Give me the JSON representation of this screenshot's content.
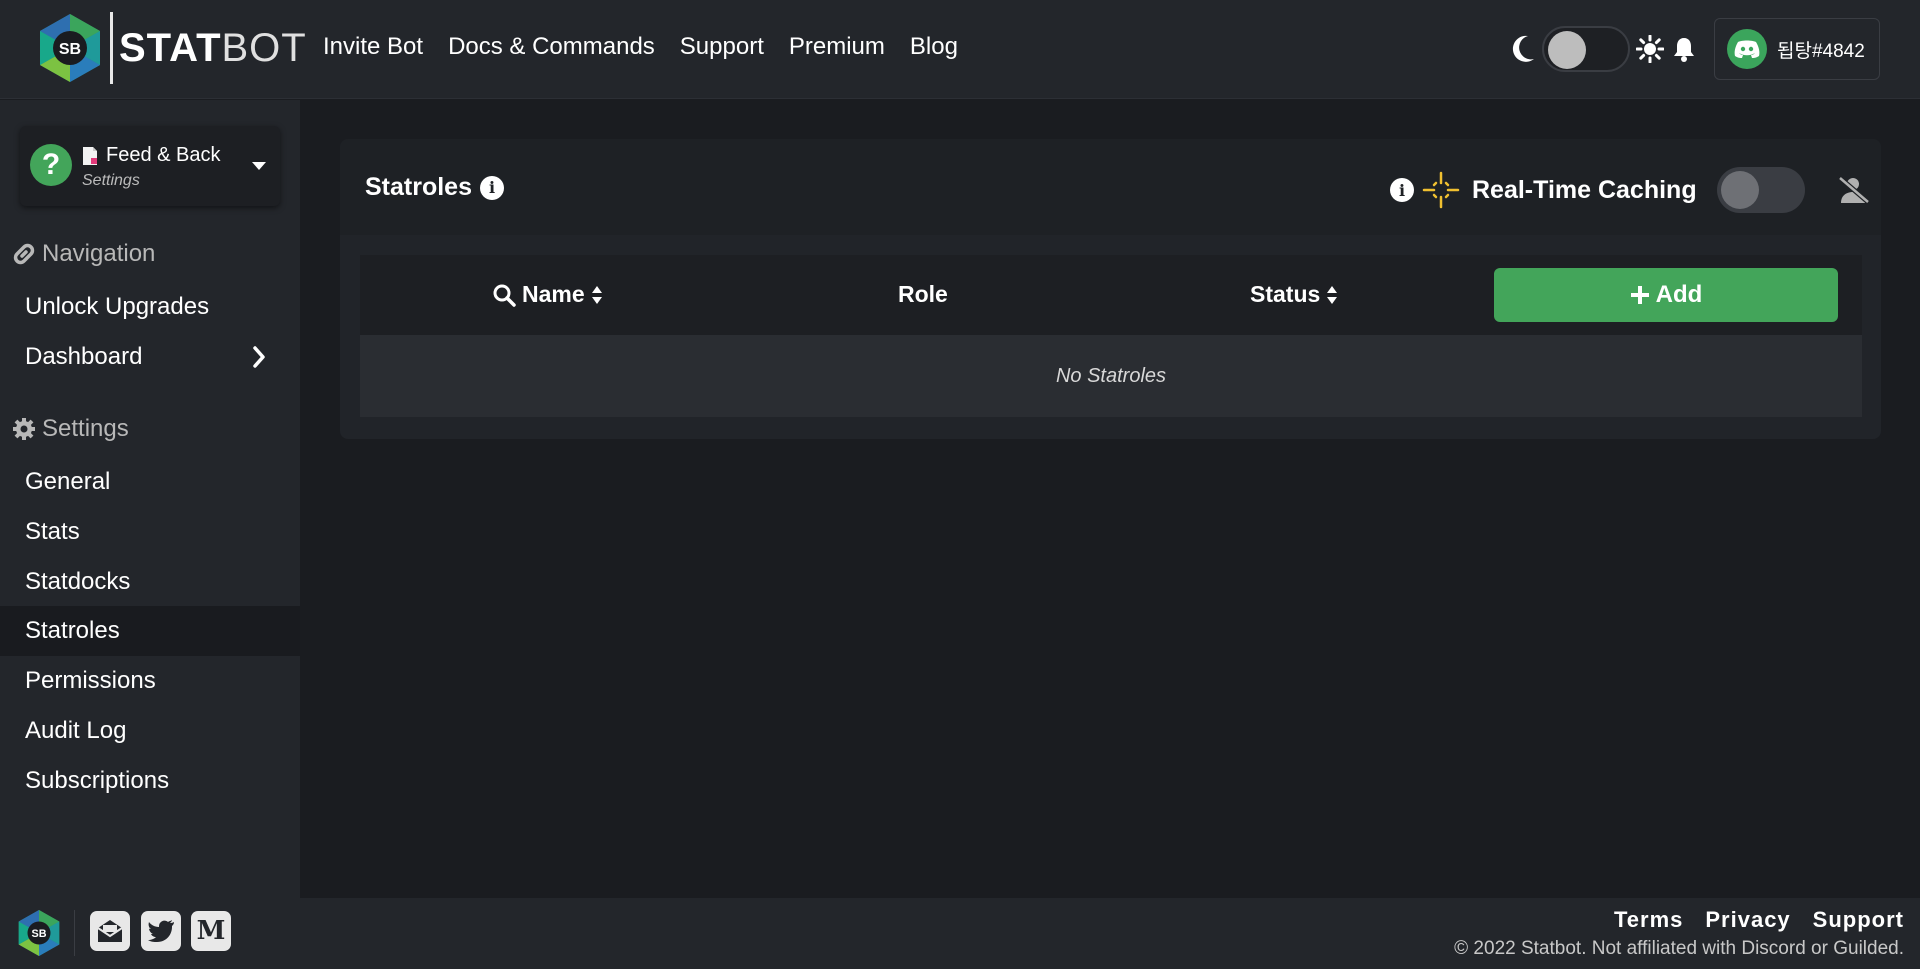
{
  "header": {
    "logo_text_bold": "STAT",
    "logo_text_light": "BOT",
    "logo_badge": "SB",
    "nav": [
      "Invite Bot",
      "Docs & Commands",
      "Support",
      "Premium",
      "Blog"
    ],
    "theme_toggle_on": false,
    "user": "됩탕#4842"
  },
  "sidebar": {
    "server": {
      "name": "Feed & Back",
      "subtitle": "Settings",
      "icon_glyph": "?"
    },
    "navigation_header": "Navigation",
    "navigation_items": [
      {
        "label": "Unlock Upgrades"
      },
      {
        "label": "Dashboard"
      }
    ],
    "settings_header": "Settings",
    "settings_items": [
      {
        "label": "General"
      },
      {
        "label": "Stats"
      },
      {
        "label": "Statdocks"
      },
      {
        "label": "Statroles",
        "active": true
      },
      {
        "label": "Permissions"
      },
      {
        "label": "Audit Log"
      },
      {
        "label": "Subscriptions"
      }
    ]
  },
  "main": {
    "title": "Statroles",
    "realtime_label": "Real-Time Caching",
    "realtime_on": false,
    "table": {
      "columns": [
        "Name",
        "Role",
        "Status"
      ],
      "add_label": "Add",
      "empty_text": "No Statroles"
    }
  },
  "footer": {
    "links": [
      "Terms",
      "Privacy",
      "Support"
    ],
    "copyright": "© 2022 Statbot. Not affiliated with Discord or Guilded.",
    "medium_glyph": "M"
  },
  "colors": {
    "accent_green": "#43a55a",
    "background": "#1a1c20",
    "panel": "#23262b",
    "caching_icon": "#f0c030"
  }
}
